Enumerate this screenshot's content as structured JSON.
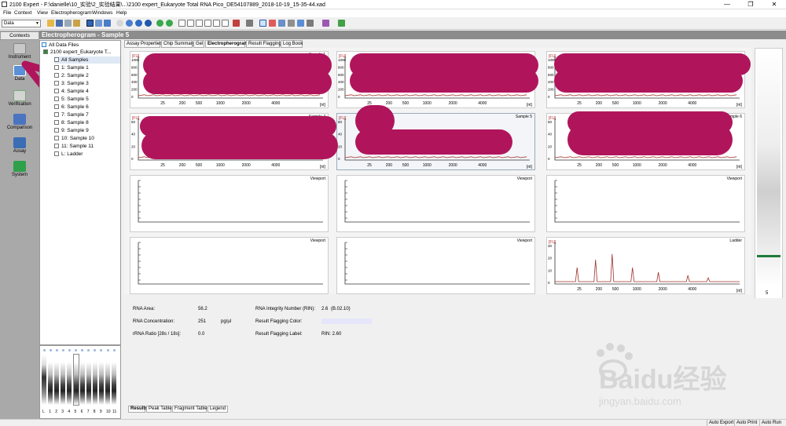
{
  "window": {
    "title": "2100 Expert - F:\\danielle\\10_实验\\2_实验结果\\...\\2100 expert_Eukaryote Total RNA Pico_DE54107889_2018-10-19_15-35-44.xad",
    "minimize": "—",
    "maximize": "❐",
    "close": "✕"
  },
  "menu": [
    "File",
    "Context",
    "View",
    "Electropherogram",
    "Windows",
    "Help"
  ],
  "toolbar": {
    "combo_value": "Data"
  },
  "rail": {
    "contexts_label": "Contexts",
    "items": [
      "Instrument",
      "Data",
      "Verification",
      "Comparison",
      "Assay",
      "System"
    ]
  },
  "tree": {
    "root": "All Data Files",
    "file": "2100 expert_Eukaryote T...",
    "samples": [
      "All Samples",
      "1: Sample 1",
      "2: Sample 2",
      "3: Sample 3",
      "4: Sample 4",
      "5: Sample 5",
      "6: Sample 6",
      "7: Sample 7",
      "8: Sample 8",
      "9: Sample 9",
      "10: Sample 10",
      "11: Sample 11",
      "L: Ladder"
    ]
  },
  "gel": {
    "lane_labels": [
      "L",
      "1",
      "2",
      "3",
      "4",
      "5",
      "6",
      "7",
      "8",
      "9",
      "10",
      "11"
    ]
  },
  "header": {
    "title": "Electropherogram - Sample 5"
  },
  "tabs": [
    "Assay Properties",
    "Chip Summary",
    "Gel",
    "Electropherogram",
    "Result Flagging",
    "Log Book"
  ],
  "charts": {
    "yunit": "[FU]",
    "xunit": "[nt]",
    "x_ticks": [
      "25",
      "200",
      "500",
      "1000",
      "2000",
      "4000"
    ],
    "captions": [
      "Sample 1",
      "",
      "",
      "Sample 4",
      "Sample 5",
      "Sample 6",
      "Viewport",
      "Viewport",
      "Viewport",
      "Viewport",
      "Viewport",
      "Ladder"
    ],
    "y_ticks_top": [
      "1000",
      "800",
      "600",
      "400",
      "200",
      "0"
    ],
    "y_ticks_mid": [
      "60",
      "40",
      "20",
      "0"
    ],
    "ladder_y_ticks": [
      "30",
      "20",
      "10",
      "0"
    ]
  },
  "right_strip": {
    "label": "5"
  },
  "results": {
    "rna_area_label": "RNA Area:",
    "rna_area_value": "56.2",
    "rna_conc_label": "RNA Concentration:",
    "rna_conc_value": "251",
    "rna_conc_unit": "pg/µl",
    "rrna_label": "rRNA Ratio [28s / 18s]:",
    "rrna_value": "0.0",
    "rin_label": "RNA Integrity Number (RIN):",
    "rin_value": "2.6",
    "rin_version": "(B.02.10)",
    "flag_color_label": "Result Flagging Color:",
    "flag_label_label": "Result Flagging Label:",
    "flag_label_value": "RIN: 2.60",
    "flag_color": "#e6e6fa"
  },
  "bottom_tabs": [
    "Results",
    "Peak Table",
    "Fragment Table",
    "Legend"
  ],
  "status": [
    "Auto Export",
    "Auto Print",
    "Auto Run"
  ],
  "watermark": {
    "brand": "Baidu经验",
    "url": "jingyan.baidu.com"
  },
  "colors": {
    "redaction": "#b0155c",
    "trace": "#a0302a",
    "header": "#8c8c8c"
  }
}
